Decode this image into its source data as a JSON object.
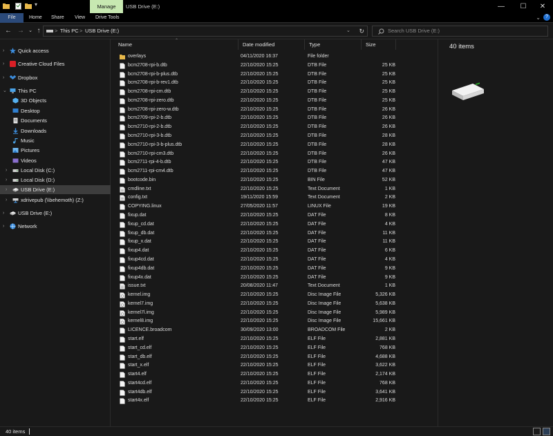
{
  "window": {
    "manage_tab": "Manage",
    "title": "USB Drive (E:)",
    "minimize": "—",
    "maximize": "☐",
    "close": "✕"
  },
  "ribbon": {
    "tabs": [
      "File",
      "Home",
      "Share",
      "View",
      "Drive Tools"
    ],
    "help": "?"
  },
  "address": {
    "segments": [
      "This PC",
      "USB Drive (E:)"
    ],
    "separator": ">",
    "search_placeholder": "Search USB Drive (E:)"
  },
  "sidebar": {
    "items": [
      {
        "label": "Quick access",
        "icon": "star-icon",
        "indent": 0
      },
      {
        "label": "Creative Cloud Files",
        "icon": "creative-cloud-icon",
        "indent": 0
      },
      {
        "label": "Dropbox",
        "icon": "dropbox-icon",
        "indent": 0
      },
      {
        "label": "This PC",
        "icon": "computer-icon",
        "indent": 0
      },
      {
        "label": "3D Objects",
        "icon": "cube-icon",
        "indent": 1
      },
      {
        "label": "Desktop",
        "icon": "desktop-icon",
        "indent": 1
      },
      {
        "label": "Documents",
        "icon": "documents-icon",
        "indent": 1
      },
      {
        "label": "Downloads",
        "icon": "download-icon",
        "indent": 1
      },
      {
        "label": "Music",
        "icon": "music-icon",
        "indent": 1
      },
      {
        "label": "Pictures",
        "icon": "pictures-icon",
        "indent": 1
      },
      {
        "label": "Videos",
        "icon": "videos-icon",
        "indent": 1
      },
      {
        "label": "Local Disk (C:)",
        "icon": "disk-icon",
        "indent": 1
      },
      {
        "label": "Local Disk (D:)",
        "icon": "disk-icon",
        "indent": 1
      },
      {
        "label": "USB Drive (E:)",
        "icon": "usb-drive-icon",
        "indent": 1,
        "selected": true
      },
      {
        "label": "xdrivepub (\\\\behemoth) (Z:)",
        "icon": "network-drive-icon",
        "indent": 1
      },
      {
        "label": "USB Drive (E:)",
        "icon": "usb-drive-icon",
        "indent": 0
      },
      {
        "label": "Network",
        "icon": "network-icon",
        "indent": 0
      }
    ]
  },
  "columns": {
    "name": "Name",
    "date": "Date modified",
    "type": "Type",
    "size": "Size"
  },
  "files": [
    {
      "name": "overlays",
      "date": "04/11/2020 16:37",
      "type": "File folder",
      "size": "",
      "kind": "folder"
    },
    {
      "name": "bcm2708-rpi-b.dtb",
      "date": "22/10/2020 15:25",
      "type": "DTB File",
      "size": "25 KB",
      "kind": "file"
    },
    {
      "name": "bcm2708-rpi-b-plus.dtb",
      "date": "22/10/2020 15:25",
      "type": "DTB File",
      "size": "25 KB",
      "kind": "file"
    },
    {
      "name": "bcm2708-rpi-b-rev1.dtb",
      "date": "22/10/2020 15:25",
      "type": "DTB File",
      "size": "25 KB",
      "kind": "file"
    },
    {
      "name": "bcm2708-rpi-cm.dtb",
      "date": "22/10/2020 15:25",
      "type": "DTB File",
      "size": "25 KB",
      "kind": "file"
    },
    {
      "name": "bcm2708-rpi-zero.dtb",
      "date": "22/10/2020 15:25",
      "type": "DTB File",
      "size": "25 KB",
      "kind": "file"
    },
    {
      "name": "bcm2708-rpi-zero-w.dtb",
      "date": "22/10/2020 15:25",
      "type": "DTB File",
      "size": "26 KB",
      "kind": "file"
    },
    {
      "name": "bcm2709-rpi-2-b.dtb",
      "date": "22/10/2020 15:25",
      "type": "DTB File",
      "size": "26 KB",
      "kind": "file"
    },
    {
      "name": "bcm2710-rpi-2-b.dtb",
      "date": "22/10/2020 15:25",
      "type": "DTB File",
      "size": "26 KB",
      "kind": "file"
    },
    {
      "name": "bcm2710-rpi-3-b.dtb",
      "date": "22/10/2020 15:25",
      "type": "DTB File",
      "size": "28 KB",
      "kind": "file"
    },
    {
      "name": "bcm2710-rpi-3-b-plus.dtb",
      "date": "22/10/2020 15:25",
      "type": "DTB File",
      "size": "28 KB",
      "kind": "file"
    },
    {
      "name": "bcm2710-rpi-cm3.dtb",
      "date": "22/10/2020 15:25",
      "type": "DTB File",
      "size": "26 KB",
      "kind": "file"
    },
    {
      "name": "bcm2711-rpi-4-b.dtb",
      "date": "22/10/2020 15:25",
      "type": "DTB File",
      "size": "47 KB",
      "kind": "file"
    },
    {
      "name": "bcm2711-rpi-cm4.dtb",
      "date": "22/10/2020 15:25",
      "type": "DTB File",
      "size": "47 KB",
      "kind": "file"
    },
    {
      "name": "bootcode.bin",
      "date": "22/10/2020 15:25",
      "type": "BIN File",
      "size": "52 KB",
      "kind": "file"
    },
    {
      "name": "cmdline.txt",
      "date": "22/10/2020 15:25",
      "type": "Text Document",
      "size": "1 KB",
      "kind": "text"
    },
    {
      "name": "config.txt",
      "date": "19/11/2020 15:59",
      "type": "Text Document",
      "size": "2 KB",
      "kind": "text"
    },
    {
      "name": "COPYING.linux",
      "date": "27/05/2020 11:57",
      "type": "LINUX File",
      "size": "19 KB",
      "kind": "file"
    },
    {
      "name": "fixup.dat",
      "date": "22/10/2020 15:25",
      "type": "DAT File",
      "size": "8 KB",
      "kind": "file"
    },
    {
      "name": "fixup_cd.dat",
      "date": "22/10/2020 15:25",
      "type": "DAT File",
      "size": "4 KB",
      "kind": "file"
    },
    {
      "name": "fixup_db.dat",
      "date": "22/10/2020 15:25",
      "type": "DAT File",
      "size": "11 KB",
      "kind": "file"
    },
    {
      "name": "fixup_x.dat",
      "date": "22/10/2020 15:25",
      "type": "DAT File",
      "size": "11 KB",
      "kind": "file"
    },
    {
      "name": "fixup4.dat",
      "date": "22/10/2020 15:25",
      "type": "DAT File",
      "size": "6 KB",
      "kind": "file"
    },
    {
      "name": "fixup4cd.dat",
      "date": "22/10/2020 15:25",
      "type": "DAT File",
      "size": "4 KB",
      "kind": "file"
    },
    {
      "name": "fixup4db.dat",
      "date": "22/10/2020 15:25",
      "type": "DAT File",
      "size": "9 KB",
      "kind": "file"
    },
    {
      "name": "fixup4x.dat",
      "date": "22/10/2020 15:25",
      "type": "DAT File",
      "size": "9 KB",
      "kind": "file"
    },
    {
      "name": "issue.txt",
      "date": "20/08/2020 11:47",
      "type": "Text Document",
      "size": "1 KB",
      "kind": "text"
    },
    {
      "name": "kernel.img",
      "date": "22/10/2020 15:25",
      "type": "Disc Image File",
      "size": "5,326 KB",
      "kind": "image"
    },
    {
      "name": "kernel7.img",
      "date": "22/10/2020 15:25",
      "type": "Disc Image File",
      "size": "5,638 KB",
      "kind": "image"
    },
    {
      "name": "kernel7l.img",
      "date": "22/10/2020 15:25",
      "type": "Disc Image File",
      "size": "5,989 KB",
      "kind": "image"
    },
    {
      "name": "kernel8.img",
      "date": "22/10/2020 15:25",
      "type": "Disc Image File",
      "size": "15,661 KB",
      "kind": "image"
    },
    {
      "name": "LICENCE.broadcom",
      "date": "30/09/2020 13:00",
      "type": "BROADCOM File",
      "size": "2 KB",
      "kind": "file"
    },
    {
      "name": "start.elf",
      "date": "22/10/2020 15:25",
      "type": "ELF File",
      "size": "2,881 KB",
      "kind": "file"
    },
    {
      "name": "start_cd.elf",
      "date": "22/10/2020 15:25",
      "type": "ELF File",
      "size": "768 KB",
      "kind": "file"
    },
    {
      "name": "start_db.elf",
      "date": "22/10/2020 15:25",
      "type": "ELF File",
      "size": "4,688 KB",
      "kind": "file"
    },
    {
      "name": "start_x.elf",
      "date": "22/10/2020 15:25",
      "type": "ELF File",
      "size": "3,622 KB",
      "kind": "file"
    },
    {
      "name": "start4.elf",
      "date": "22/10/2020 15:25",
      "type": "ELF File",
      "size": "2,174 KB",
      "kind": "file"
    },
    {
      "name": "start4cd.elf",
      "date": "22/10/2020 15:25",
      "type": "ELF File",
      "size": "768 KB",
      "kind": "file"
    },
    {
      "name": "start4db.elf",
      "date": "22/10/2020 15:25",
      "type": "ELF File",
      "size": "3,641 KB",
      "kind": "file"
    },
    {
      "name": "start4x.elf",
      "date": "22/10/2020 15:25",
      "type": "ELF File",
      "size": "2,916 KB",
      "kind": "file"
    }
  ],
  "details": {
    "count": "40 items"
  },
  "status": {
    "count": "40 items"
  },
  "colors": {
    "background": "#191919",
    "titlebar": "#000000",
    "manage_tab": "#c7e8b1",
    "file_tab": "#2b4a7a",
    "selection": "#3d3d3d",
    "folder": "#e8b84a",
    "accent": "#1f6fd1"
  }
}
